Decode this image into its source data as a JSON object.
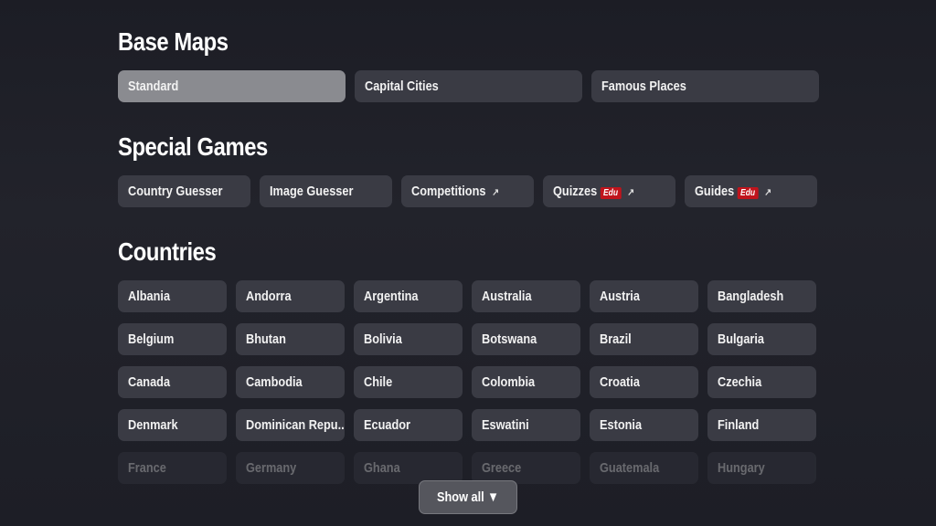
{
  "sections": {
    "base_maps": {
      "title": "Base Maps",
      "items": [
        "Standard",
        "Capital Cities",
        "Famous Places"
      ],
      "active": "Standard"
    },
    "special_games": {
      "title": "Special Games",
      "items": [
        {
          "label": "Country Guesser",
          "badge": null,
          "external": false
        },
        {
          "label": "Image Guesser",
          "badge": null,
          "external": false
        },
        {
          "label": "Competitions",
          "badge": null,
          "external": true
        },
        {
          "label": "Quizzes",
          "badge": "Edu",
          "external": true
        },
        {
          "label": "Guides",
          "badge": "Edu",
          "external": true
        }
      ]
    },
    "countries": {
      "title": "Countries",
      "items": [
        "Albania",
        "Andorra",
        "Argentina",
        "Australia",
        "Austria",
        "Bangladesh",
        "Belgium",
        "Bhutan",
        "Bolivia",
        "Botswana",
        "Brazil",
        "Bulgaria",
        "Canada",
        "Cambodia",
        "Chile",
        "Colombia",
        "Croatia",
        "Czechia",
        "Denmark",
        "Dominican Repu...",
        "Ecuador",
        "Eswatini",
        "Estonia",
        "Finland",
        "France",
        "Germany",
        "Ghana",
        "Greece",
        "Guatemala",
        "Hungary"
      ]
    }
  },
  "show_all": "Show all ▼",
  "icons": {
    "external": "↗"
  },
  "colors": {
    "edu_badge": "#c0141c",
    "active_button": "#8a8b90",
    "button": "#3a3b44"
  }
}
